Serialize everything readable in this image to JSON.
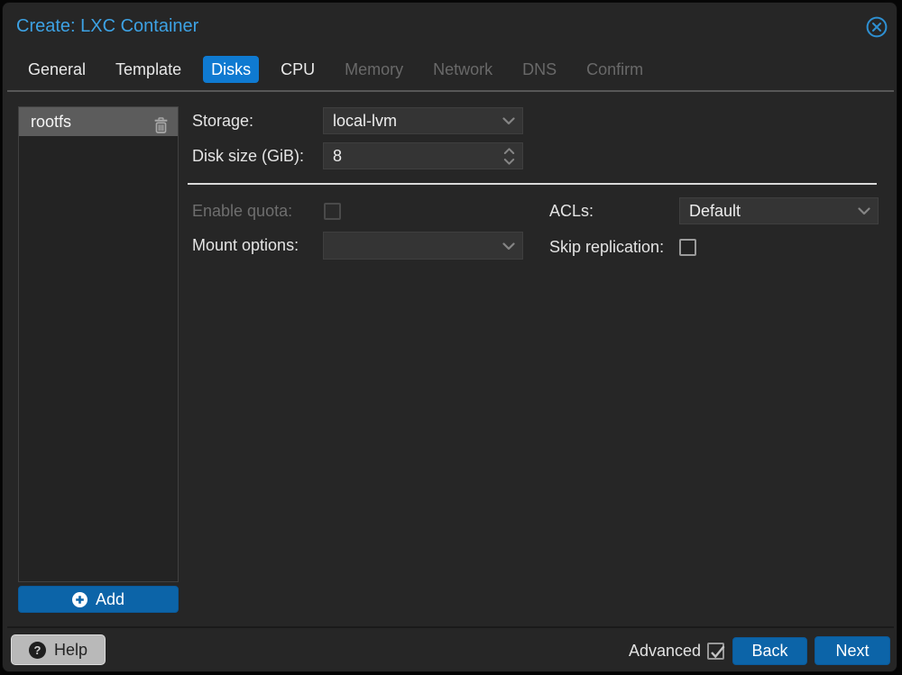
{
  "window": {
    "title": "Create: LXC Container"
  },
  "tabs": [
    {
      "label": "General",
      "state": "enabled",
      "active": false
    },
    {
      "label": "Template",
      "state": "enabled",
      "active": false
    },
    {
      "label": "Disks",
      "state": "enabled",
      "active": true
    },
    {
      "label": "CPU",
      "state": "enabled",
      "active": false
    },
    {
      "label": "Memory",
      "state": "disabled",
      "active": false
    },
    {
      "label": "Network",
      "state": "disabled",
      "active": false
    },
    {
      "label": "DNS",
      "state": "disabled",
      "active": false
    },
    {
      "label": "Confirm",
      "state": "disabled",
      "active": false
    }
  ],
  "disk_list": {
    "items": [
      {
        "name": "rootfs",
        "selected": true
      }
    ],
    "add_label": "Add"
  },
  "form": {
    "storage": {
      "label": "Storage:",
      "value": "local-lvm",
      "type": "dropdown"
    },
    "disk_size": {
      "label": "Disk size (GiB):",
      "value": "8",
      "type": "spinner"
    },
    "enable_quota": {
      "label": "Enable quota:",
      "checked": false,
      "disabled": true
    },
    "acls": {
      "label": "ACLs:",
      "value": "Default",
      "type": "dropdown"
    },
    "mount_options": {
      "label": "Mount options:",
      "value": "",
      "type": "dropdown"
    },
    "skip_replication": {
      "label": "Skip replication:",
      "checked": false,
      "disabled": false
    }
  },
  "footer": {
    "help_label": "Help",
    "advanced": {
      "label": "Advanced",
      "checked": true
    },
    "back_label": "Back",
    "next_label": "Next"
  },
  "colors": {
    "accent_blue": "#0c64a8",
    "active_tab_blue": "#0f7ad1",
    "title_blue": "#3da2e4",
    "dialog_bg": "#262626"
  }
}
